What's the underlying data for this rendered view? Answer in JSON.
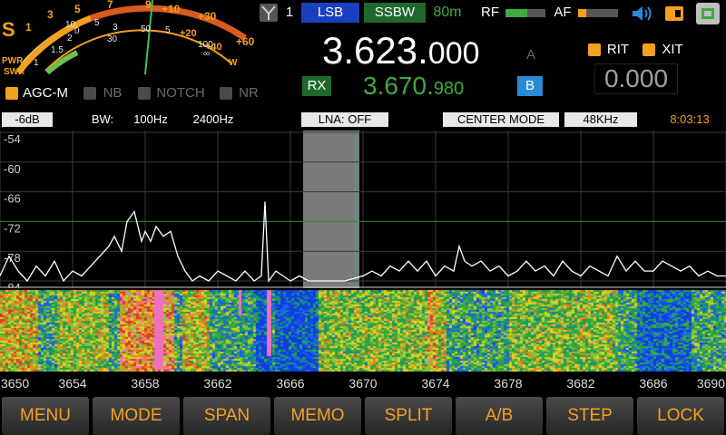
{
  "smeter": {
    "s_label": "S",
    "s_scale": [
      "1",
      "3",
      "5",
      "7",
      "9",
      "+10",
      "+20",
      "+30",
      "+40",
      "+60"
    ],
    "swr_scale": [
      "1",
      "1.5",
      "2",
      "3",
      "5",
      "∞"
    ],
    "pwr_scale": [
      "0",
      "5",
      "10",
      "30",
      "50",
      "100",
      "W"
    ],
    "pwr_label": "PWR",
    "swr_label": "SWR"
  },
  "top": {
    "antenna_num": "1",
    "mode": "LSB",
    "filter": "SSBW",
    "band": "80m",
    "rf_label": "RF",
    "af_label": "AF",
    "rf_level": 0.55,
    "af_level": 0.2
  },
  "vfo": {
    "main_freq_big": "3.623.",
    "main_freq_small": "000",
    "main_tag": "A",
    "rx_label": "RX",
    "sub_freq_big": "3.670.",
    "sub_freq_small": "980",
    "sub_tag": "B",
    "rit_label": "RIT",
    "xit_label": "XIT",
    "rit_value": "0.000"
  },
  "toggles": [
    {
      "label": "AGC-M",
      "on": true
    },
    {
      "label": "NB",
      "on": false
    },
    {
      "label": "NOTCH",
      "on": false
    },
    {
      "label": "NR",
      "on": false
    }
  ],
  "status": {
    "gain": "-6dB",
    "bw_label": "BW:",
    "bw1": "100Hz",
    "bw2": "2400Hz",
    "lna": "LNA: OFF",
    "mode": "CENTER MODE",
    "span": "48KHz",
    "time": "8:03:13"
  },
  "chart_data": {
    "type": "line",
    "y_ticks": [
      "-54",
      "-60",
      "-66",
      "-72",
      "-78",
      "-84"
    ],
    "ylim": [
      -84,
      -54
    ],
    "x_ticks": [
      "3650",
      "3654",
      "3658",
      "3662",
      "3666",
      "3670",
      "3674",
      "3678",
      "3682",
      "3686",
      "3690"
    ],
    "xlim": [
      3650,
      3690
    ],
    "passband": [
      3666.7,
      3669.8
    ],
    "marker": 3669.6,
    "series": [
      {
        "x": [
          3650,
          3650.5,
          3651,
          3651.5,
          3652,
          3652.5,
          3653,
          3653.5,
          3654,
          3654.5,
          3655,
          3655.5,
          3656,
          3656.3,
          3656.7,
          3657,
          3657.4,
          3657.8,
          3658,
          3658.3,
          3658.6,
          3659,
          3659.4,
          3659.8,
          3660.2,
          3660.6,
          3661,
          3661.5,
          3662,
          3662.5,
          3663,
          3663.5,
          3664,
          3664.4,
          3664.6,
          3664.8,
          3665.2,
          3665.6,
          3666,
          3666.5,
          3667,
          3668,
          3669,
          3670,
          3670.5,
          3671,
          3671.5,
          3672,
          3672.5,
          3673,
          3673.5,
          3674,
          3674.5,
          3675,
          3675.3,
          3675.6,
          3676,
          3676.5,
          3677,
          3677.5,
          3678,
          3678.5,
          3679,
          3679.5,
          3680,
          3680.5,
          3681,
          3681.5,
          3682,
          3682.5,
          3683,
          3683.5,
          3684,
          3684.5,
          3685,
          3685.5,
          3686,
          3686.5,
          3687,
          3687.5,
          3688,
          3688.5,
          3689,
          3689.5,
          3690
        ],
        "y": [
          -83,
          -79,
          -82,
          -84,
          -81,
          -83,
          -80,
          -84,
          -82,
          -83,
          -81,
          -79,
          -77,
          -75,
          -78,
          -72,
          -70,
          -76,
          -74,
          -76,
          -73,
          -75,
          -74,
          -79,
          -82,
          -84,
          -83,
          -84,
          -82,
          -83,
          -84,
          -82,
          -84,
          -83,
          -68,
          -84,
          -82,
          -83,
          -84,
          -83,
          -84,
          -84,
          -84,
          -83,
          -82,
          -83,
          -81,
          -82,
          -80,
          -82,
          -80,
          -83,
          -81,
          -82,
          -77,
          -80,
          -81,
          -80,
          -82,
          -81,
          -83,
          -82,
          -80,
          -82,
          -81,
          -83,
          -80,
          -82,
          -83,
          -81,
          -82,
          -83,
          -79,
          -82,
          -80,
          -82,
          -82,
          -80,
          -81,
          -82,
          -81,
          -83,
          -82,
          -83,
          -83
        ]
      }
    ]
  },
  "buttons": [
    "MENU",
    "MODE",
    "SPAN",
    "MEMO",
    "SPLIT",
    "A/B",
    "STEP",
    "LOCK"
  ],
  "colors": {
    "accent": "#f5a020",
    "mode_blue": "#1a3fbf",
    "filter_green": "#1e6a2e",
    "rx_green": "#3faa3f",
    "vfo_blue": "#2a8ad8"
  },
  "icons": [
    "antenna-icon",
    "speaker-icon",
    "sd-card-icon",
    "network-icon"
  ]
}
